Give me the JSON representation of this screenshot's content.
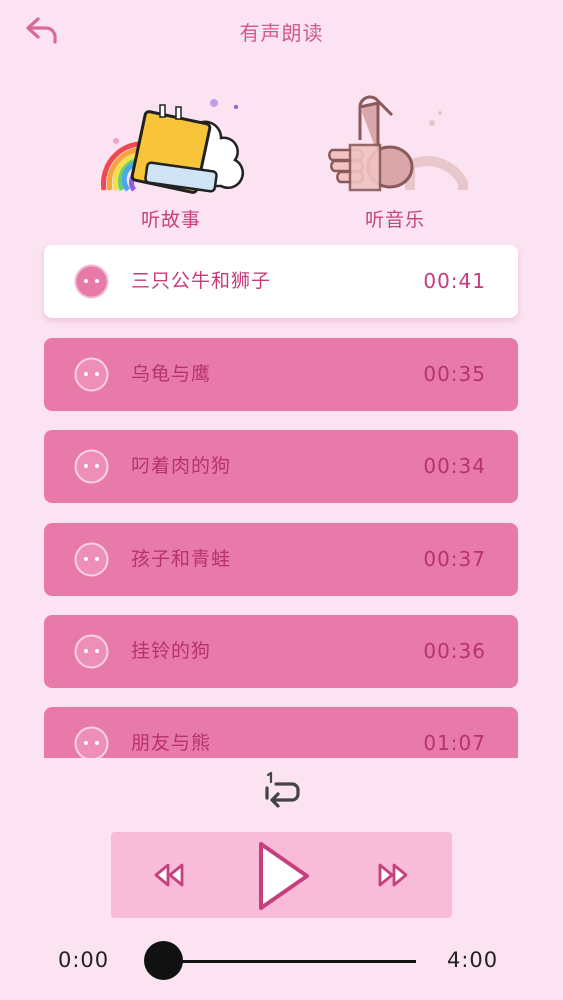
{
  "header": {
    "title": "有声朗读",
    "back_icon": "back-arrow-icon"
  },
  "categories": [
    {
      "label": "听故事",
      "icon": "book-rainbow-icon",
      "active": true
    },
    {
      "label": "听音乐",
      "icon": "music-note-hand-icon",
      "active": false
    }
  ],
  "tracks": [
    {
      "name": "三只公牛和狮子",
      "duration": "00:41",
      "active": true
    },
    {
      "name": "乌龟与鹰",
      "duration": "00:35",
      "active": false
    },
    {
      "name": "叼着肉的狗",
      "duration": "00:34",
      "active": false
    },
    {
      "name": "孩子和青蛙",
      "duration": "00:37",
      "active": false
    },
    {
      "name": "挂铃的狗",
      "duration": "00:36",
      "active": false
    },
    {
      "name": "朋友与熊",
      "duration": "01:07",
      "active": false
    }
  ],
  "player": {
    "repeat_icon": "repeat-one-icon",
    "current_time": "0:00",
    "total_time": "4:00",
    "progress": 0.0
  },
  "colors": {
    "background": "#fbe3f1",
    "row": "#e77aa8",
    "accent": "#c83a7c",
    "controls_bg": "#f8bcd8"
  }
}
